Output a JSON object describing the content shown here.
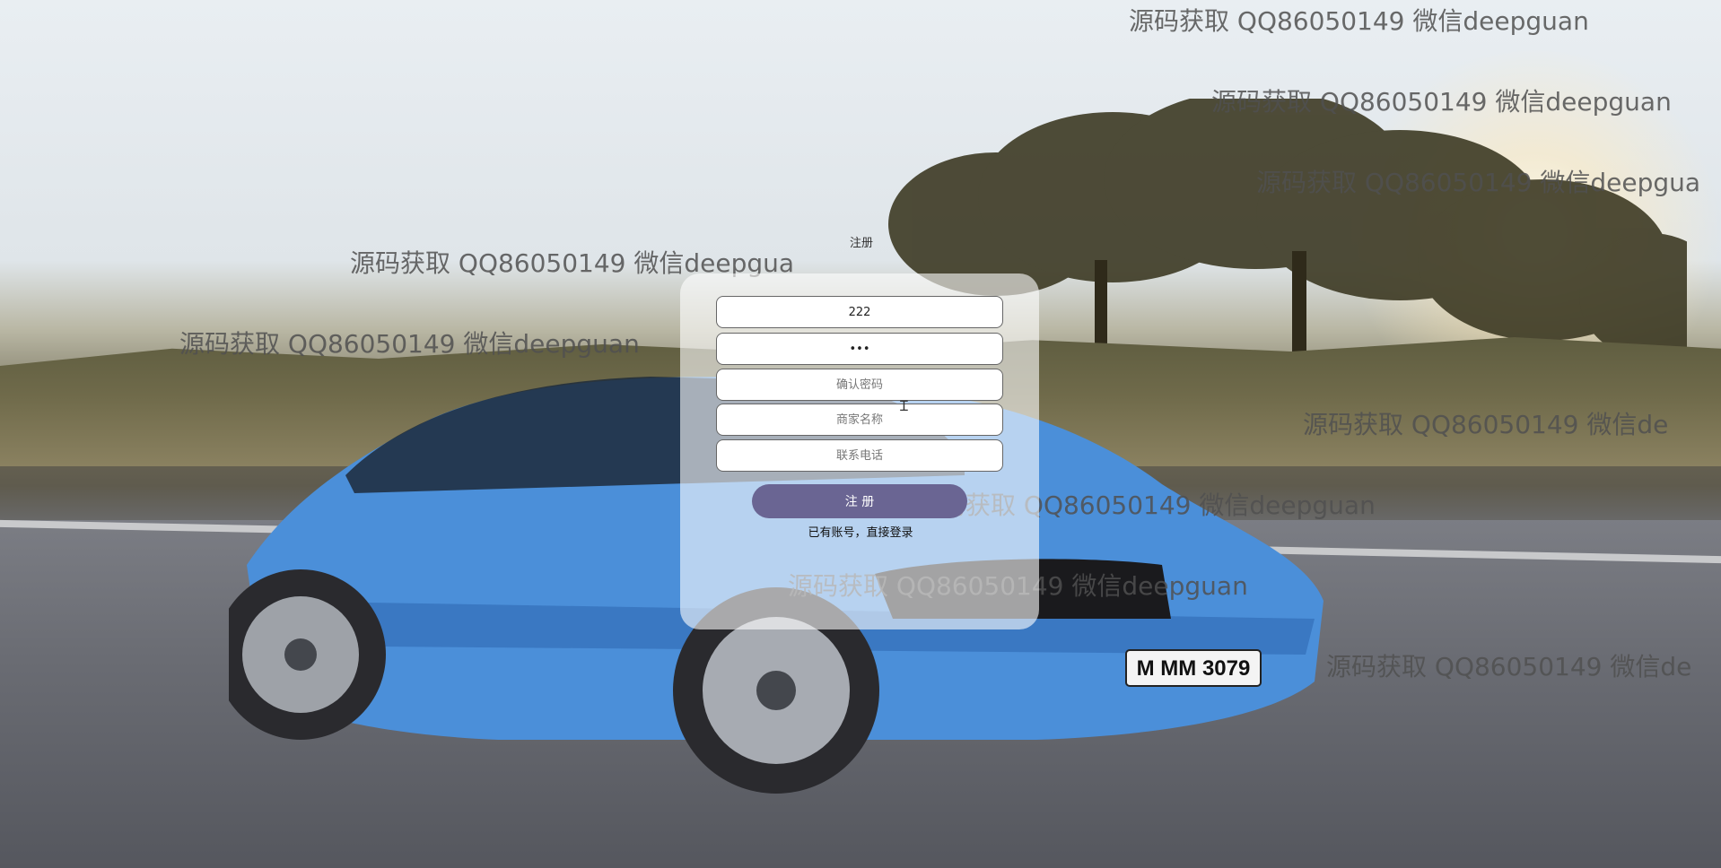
{
  "form": {
    "title": "注册",
    "username_value": "222",
    "password_value": "•••",
    "confirm_placeholder": "确认密码",
    "merchant_placeholder": "商家名称",
    "phone_placeholder": "联系电话",
    "register_label": "注 册",
    "login_link": "已有账号，直接登录"
  },
  "colors": {
    "button": "#6a6593",
    "panel": "rgba(255,255,255,0.6)"
  },
  "watermarks": [
    "源码获取 QQ86050149 微信deepguan",
    "源码获取 QQ86050149 微信deepguan",
    "源码获取 QQ86050149 微信deepgua",
    "源码获取 QQ86050149 微信deepgua",
    "源码获取 QQ86050149 微信deepguan",
    "源码获取 QQ86050149 微信de",
    "源码获取 QQ86050149 微信deepguan",
    "源码获取 QQ86050149 微信deepguan",
    "源码获取 QQ86050149 微信de"
  ],
  "background": {
    "car_plate": "M MM 3079"
  }
}
